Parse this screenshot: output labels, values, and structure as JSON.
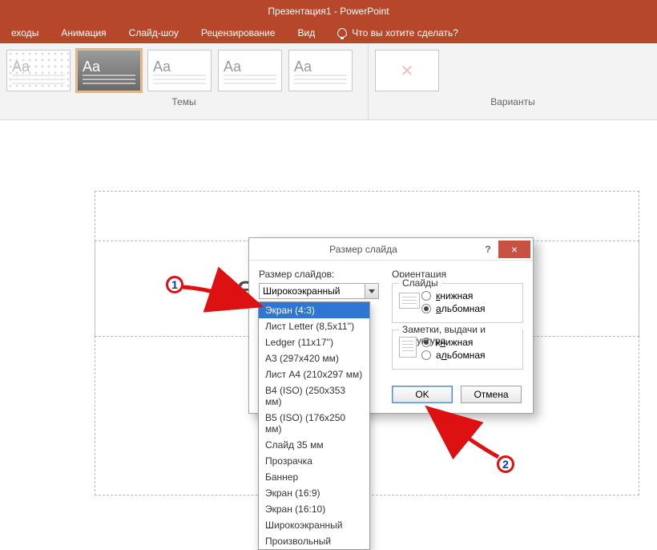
{
  "app": {
    "title": "Презентация1 - PowerPoint"
  },
  "tabs": {
    "t0": "еходы",
    "t1": "Анимация",
    "t2": "Слайд-шоу",
    "t3": "Рецензирование",
    "t4": "Вид",
    "tell": "Что вы хотите сделать?"
  },
  "ribbon": {
    "themes_label": "Темы",
    "variants_label": "Варианты",
    "aa": "Aa"
  },
  "slide": {
    "title_placeholder": "Заголовок слайда"
  },
  "dialog": {
    "title": "Размер слайда",
    "size_label": "Размер слайдов:",
    "combo_value": "Широкоэкранный",
    "orientation_label": "Ориентация",
    "slides_group": "Слайды",
    "notes_group": "Заметки, выдачи и структура",
    "portrait": "книжная",
    "landscape": "альбомная",
    "portrait2": "книжная",
    "landscape2": "альбомная",
    "ok": "OK",
    "cancel": "Отмена",
    "help": "?",
    "close": "×"
  },
  "dropdown": {
    "o0": "Экран (4:3)",
    "o1": "Лист Letter (8,5x11'')",
    "o2": "Ledger (11x17'')",
    "o3": "A3 (297x420 мм)",
    "o4": "Лист A4 (210x297 мм)",
    "o5": "B4 (ISO) (250x353 мм)",
    "o6": "B5 (ISO) (176x250 мм)",
    "o7": "Слайд 35 мм",
    "o8": "Прозрачка",
    "o9": "Баннер",
    "o10": "Экран (16:9)",
    "o11": "Экран (16:10)",
    "o12": "Широкоэкранный",
    "o13": "Произвольный"
  },
  "anno": {
    "n1": "1",
    "n2": "2"
  }
}
